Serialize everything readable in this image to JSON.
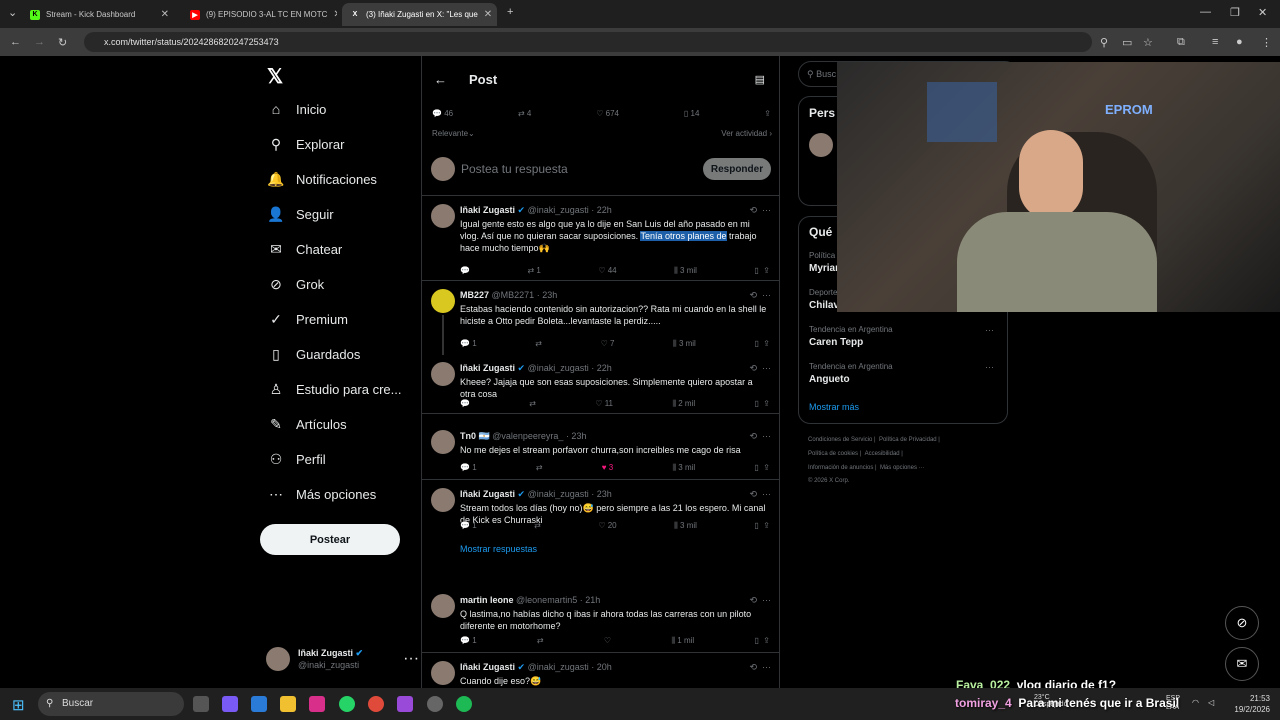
{
  "browser": {
    "tabs": [
      {
        "label": "Stream - Kick Dashboard",
        "fav": "K",
        "color": "#53fc18"
      },
      {
        "label": "(9) EPISODIO 3-AL TC EN MOTC",
        "fav": "▶",
        "color": "#ff0000"
      },
      {
        "label": "(3) Iñaki Zugasti en X: \"Les que",
        "fav": "X",
        "color": "#000000"
      }
    ],
    "url": "x.com/twitter/status/2024286820247253473"
  },
  "sidebar": {
    "items": [
      {
        "label": "Inicio",
        "icon": "home-icon",
        "glyph": "⌂"
      },
      {
        "label": "Explorar",
        "icon": "search-icon",
        "glyph": "⚲"
      },
      {
        "label": "Notificaciones",
        "icon": "bell-icon",
        "glyph": "🔔"
      },
      {
        "label": "Seguir",
        "icon": "add-user-icon",
        "glyph": "👤"
      },
      {
        "label": "Chatear",
        "icon": "mail-icon",
        "glyph": "✉"
      },
      {
        "label": "Grok",
        "icon": "grok-icon",
        "glyph": "⊘"
      },
      {
        "label": "Premium",
        "icon": "premium-icon",
        "glyph": "✓"
      },
      {
        "label": "Guardados",
        "icon": "bookmark-icon",
        "glyph": "▯"
      },
      {
        "label": "Estudio para cre...",
        "icon": "studio-icon",
        "glyph": "♙"
      },
      {
        "label": "Artículos",
        "icon": "articles-icon",
        "glyph": "✎"
      },
      {
        "label": "Perfil",
        "icon": "profile-icon",
        "glyph": "⚇"
      },
      {
        "label": "Más opciones",
        "icon": "more-icon",
        "glyph": "⋯"
      }
    ],
    "post_button": "Postear",
    "account": {
      "name": "Iñaki Zugasti",
      "handle": "@inaki_zugasti"
    }
  },
  "main": {
    "title": "Post",
    "stats": {
      "replies": "46",
      "reposts": "4",
      "likes": "674",
      "bookmarks": "14"
    },
    "sort": "Relevante",
    "activity": "Ver actividad",
    "compose_placeholder": "Postea tu respuesta",
    "reply_button": "Responder",
    "show_replies": "Mostrar respuestas",
    "replies": [
      {
        "name": "Iñaki Zugasti",
        "handle": "@inaki_zugasti",
        "time": "· 22h",
        "text_a": "Igual gente esto es algo que ya lo dije en San Luis del año pasado en mi vlog. Así que no quieran sacar suposiciones. ",
        "text_hl": "Tenía otros planes de",
        "text_b": " trabajo hace mucho tiempo🙌",
        "r": "",
        "rt": "1",
        "l": "44",
        "v": "3 mil"
      },
      {
        "name": "MB227",
        "handle": "@MB2271",
        "time": "· 23h",
        "text_a": "Estabas haciendo contenido sin autorizacion?? Rata mi cuando en la shell le hiciste a Otto pedir Boleta...levantaste la perdiz.....",
        "text_hl": "",
        "text_b": "",
        "r": "1",
        "rt": "",
        "l": "7",
        "v": "3 mil"
      },
      {
        "name": "Iñaki Zugasti",
        "handle": "@inaki_zugasti",
        "time": "· 22h",
        "text_a": "Kheee? Jajaja que son esas suposiciones. Simplemente quiero apostar a otra cosa",
        "text_hl": "",
        "text_b": "",
        "r": "",
        "rt": "",
        "l": "11",
        "v": "2 mil"
      },
      {
        "name": "Tn0 🇦🇷",
        "handle": "@valenpeereyra_",
        "time": "· 23h",
        "text_a": "No me dejes el stream porfavorr churra,son increibles me cago de risa",
        "text_hl": "",
        "text_b": "",
        "r": "1",
        "rt": "",
        "l": "3",
        "v": "3 mil"
      },
      {
        "name": "Iñaki Zugasti",
        "handle": "@inaki_zugasti",
        "time": "· 23h",
        "text_a": "Stream todos los días (hoy no)😅 pero siempre a las 21 los espero. Mi canal de Kick es Churraski",
        "text_hl": "",
        "text_b": "",
        "r": "1",
        "rt": "",
        "l": "20",
        "v": "3 mil"
      },
      {
        "name": "martin leone",
        "handle": "@leonemartin5",
        "time": "· 21h",
        "text_a": "Q lastima,no habías dicho q ibas ir ahora todas las carreras con un piloto diferente en motorhome?",
        "text_hl": "",
        "text_b": "",
        "r": "1",
        "rt": "",
        "l": "",
        "v": "1 mil"
      },
      {
        "name": "Iñaki Zugasti",
        "handle": "@inaki_zugasti",
        "time": "· 20h",
        "text_a": "Cuando dije eso?😅",
        "text_hl": "",
        "text_b": "",
        "r": "",
        "rt": "",
        "l": "",
        "v": ""
      }
    ]
  },
  "right": {
    "search_placeholder": "Busc",
    "persons_title": "Pers",
    "whats_title": "Qué",
    "trends": [
      {
        "cat": "Política",
        "name": "Myriar"
      },
      {
        "cat": "Deporte",
        "name": "Chilav"
      },
      {
        "cat": "Tendencia en Argentina",
        "name": "Caren Tepp"
      },
      {
        "cat": "Tendencia en Argentina",
        "name": "Angueto"
      }
    ],
    "show_more": "Mostrar más",
    "footer": [
      "Condiciones de Servicio",
      "Política de Privacidad",
      "Política de cookies",
      "Accesibilidad",
      "Información de anuncios",
      "Más opciones ···",
      "© 2026 X Corp."
    ]
  },
  "overlay": {
    "chat": [
      {
        "user": "Fava_022",
        "msg": "vlog diario de f1?"
      },
      {
        "user": "tomiray_4",
        "msg": "Para mi tenés que ir a Brasil"
      }
    ],
    "cam_text": [
      "EPROM"
    ]
  },
  "taskbar": {
    "search": "Buscar",
    "lang": "ESP",
    "lang2": "LAA",
    "time": "21:53",
    "date": "19/2/2026",
    "weather": "23°C",
    "weather_desc": "Despejado"
  }
}
